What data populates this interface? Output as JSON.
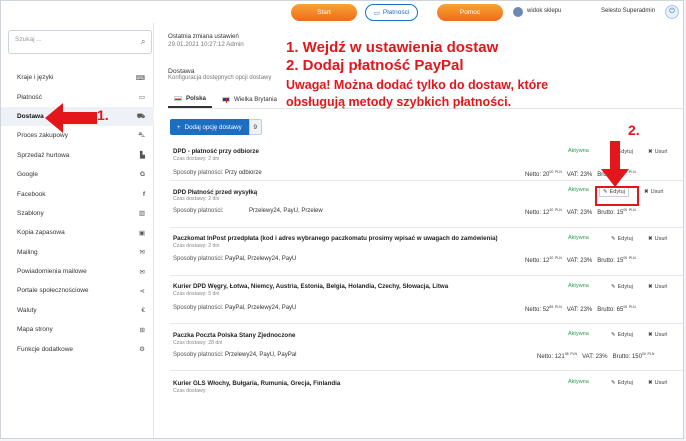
{
  "topbar": {
    "start_label": "Start",
    "payments_label": "Płatności",
    "help_label": "Pomoc",
    "shop_view_label": "widok sklepu",
    "user_label": "Selesto Superadmin"
  },
  "sidebar": {
    "search_placeholder": "Szukaj ...",
    "items": [
      {
        "label": "Kraje i języki",
        "icon": "language-icon"
      },
      {
        "label": "Płatność",
        "icon": "credit-card-icon"
      },
      {
        "label": "Dostawa",
        "icon": "truck-icon",
        "active": true
      },
      {
        "label": "Proces zakupowy",
        "icon": "cart-icon"
      },
      {
        "label": "Sprzedaż hurtowa",
        "icon": "factory-icon"
      },
      {
        "label": "Google",
        "icon": "google-icon"
      },
      {
        "label": "Facebook",
        "icon": "facebook-icon"
      },
      {
        "label": "Szablony",
        "icon": "columns-icon"
      },
      {
        "label": "Kopia zapasowa",
        "icon": "save-icon"
      },
      {
        "label": "Mailing",
        "icon": "envelope-icon"
      },
      {
        "label": "Powiadomienia mailowe",
        "icon": "envelope-icon"
      },
      {
        "label": "Portale społecznościowe",
        "icon": "share-icon"
      },
      {
        "label": "Waluty",
        "icon": "euro-icon"
      },
      {
        "label": "Mapa strony",
        "icon": "sitemap-icon"
      },
      {
        "label": "Funkcje dodatkowe",
        "icon": "cogs-icon"
      }
    ]
  },
  "header": {
    "last_change_title": "Ostatnia zmiana ustawień",
    "last_change_date": "29.01.2021",
    "last_change_time": "10:27:12",
    "last_change_user": "Admin"
  },
  "section": {
    "title": "Dostawa",
    "subtitle": "Konfiguracja dostępnych opcji dostawy",
    "tabs": [
      "Polska",
      "Wielka Brytania"
    ],
    "add_label": "Dodaj opcję dostawy",
    "count": "9"
  },
  "labels": {
    "time_prefix": "Czas dostawy:",
    "payments_prefix": "Sposoby płatności:",
    "netto": "Netto:",
    "vat": "VAT:",
    "brutto": "Brutto:",
    "currency": "PLN",
    "active": "Aktywna",
    "edit": "Edytuj",
    "delete": "Usuń"
  },
  "shipping": [
    {
      "title": "DPD - płatność przy odbiorze",
      "time": "2 dni",
      "payments": "Przy odbiorze",
      "netto": "20",
      "netto_dec": "00",
      "vat": "23%",
      "brutto": "20",
      "brutto_dec": "00"
    },
    {
      "title": "DPD Płatność przed wysyłką",
      "time": "2 dni",
      "payments": "Przelewy24, PayU, Przelew",
      "netto": "12",
      "netto_dec": "20",
      "vat": "23%",
      "brutto": "15",
      "brutto_dec": "00"
    },
    {
      "title": "Paczkomat InPost przedpłata (kod i adres wybranego paczkomatu prosimy wpisać w uwagach do zamówienia)",
      "time": "2 dni",
      "payments": "PayPal, Przelewy24, PayU",
      "netto": "12",
      "netto_dec": "20",
      "vat": "23%",
      "brutto": "15",
      "brutto_dec": "00"
    },
    {
      "title": "Kurier DPD Węgry, Łotwa, Niemcy, Austria, Estonia, Belgia, Holandia, Czechy, Słowacja, Litwa",
      "time": "5 dni",
      "payments": "PayPal, Przelewy24, PayU",
      "netto": "52",
      "netto_dec": "85",
      "vat": "23%",
      "brutto": "65",
      "brutto_dec": "00"
    },
    {
      "title": "Paczka Poczta Polska Stany Zjednoczone",
      "time": "28 dni",
      "payments": "Przelewy24, PayU, PayPal",
      "netto": "121",
      "netto_dec": "95",
      "vat": "23%",
      "brutto": "150",
      "brutto_dec": "00"
    },
    {
      "title": "Kurier GLS Włochy, Bułgaria, Rumunia, Grecja, Finlandia",
      "time": "",
      "payments": "",
      "netto": "",
      "netto_dec": "",
      "vat": "",
      "brutto": "",
      "brutto_dec": ""
    }
  ],
  "annotations": {
    "line1": "1. Wejdź w ustawienia dostaw",
    "line2": "2. Dodaj płatność PayPal",
    "line3": "Uwaga! Można dodać tylko do dostaw, które",
    "line4": "obsługują metody szybkich płatności.",
    "marker1": "1.",
    "marker2": "2.",
    "color": "#e3161c"
  }
}
